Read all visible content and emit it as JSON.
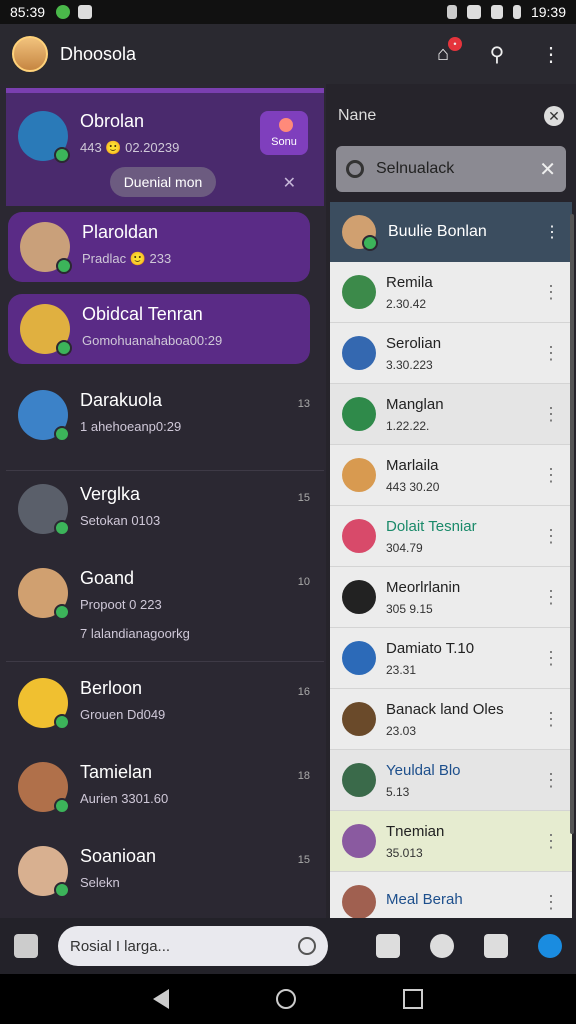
{
  "status": {
    "left_time": "85:39",
    "right_time": "19:39"
  },
  "appbar": {
    "title": "Dhoosola"
  },
  "pinned": {
    "name": "Obrolan",
    "sub": "443 🙂 02.20239",
    "pill": "Duenial mon",
    "tag": "Sonu"
  },
  "chats": [
    {
      "name": "Plaroldan",
      "sub": "Pradlac 🙂 233",
      "time": "",
      "highlight": true,
      "color": "#c9a07a"
    },
    {
      "name": "Obidcal Tenran",
      "sub": "Gomohuanahaboa00:29",
      "time": "",
      "highlight": true,
      "color": "#e0b040"
    },
    {
      "name": "Darakuola",
      "sub": "1 ahehoeanp0:29",
      "time": "13",
      "highlight": false,
      "color": "#3c82c8"
    },
    {
      "name": "Verglka",
      "sub": "Setokan 0103",
      "time": "15",
      "highlight": false,
      "color": "#5a5f6a"
    },
    {
      "name": "Goand",
      "sub": "Propoot 0 223",
      "time": "10",
      "highlight": false,
      "color": "#d0a070"
    },
    {
      "name": "Berloon",
      "sub": "Grouen Dd049",
      "time": "16",
      "highlight": false,
      "color": "#f0c030"
    },
    {
      "name": "Tamielan",
      "sub": "Aurien 3301.60",
      "time": "18",
      "highlight": false,
      "color": "#b0704a"
    },
    {
      "name": "Soanioan",
      "sub": "Selekn",
      "time": "15",
      "highlight": false,
      "color": "#d8b090"
    }
  ],
  "extra_line": "7 lalandianagoorkg",
  "right": {
    "head": "Nane",
    "search_value": "Selnualack",
    "contact_header": "Buulie Bonlan",
    "contacts": [
      {
        "name": "Remila",
        "sub": "2.30.42",
        "style": "",
        "color": "#3c8a4a"
      },
      {
        "name": "Serolian",
        "sub": "3.30.223",
        "style": "",
        "color": "#3468b0"
      },
      {
        "name": "Manglan",
        "sub": "1.22.22.",
        "style": "",
        "color": "#2f8a4a"
      },
      {
        "name": "Marlaila",
        "sub": "443 30.20",
        "style": "",
        "color": "#d89a50"
      },
      {
        "name": "Dolait Tesniar",
        "sub": "304.79",
        "style": "accent",
        "color": "#d84a6a"
      },
      {
        "name": "Meorlrlanin",
        "sub": "305 9.15",
        "style": "",
        "color": "#222"
      },
      {
        "name": "Damiato T.10",
        "sub": "23.31",
        "style": "",
        "color": "#2c6ab8"
      },
      {
        "name": "Banack land Oles",
        "sub": "23.03",
        "style": "",
        "color": "#6a4a2a"
      },
      {
        "name": "Yeuldal Blo",
        "sub": "5.13",
        "style": "blue",
        "color": "#3a6a4a"
      },
      {
        "name": "Tnemian",
        "sub": "35.013",
        "style": "",
        "color": "#8a5aa0"
      },
      {
        "name": "Meal Berah",
        "sub": "",
        "style": "blue",
        "color": "#a06050"
      }
    ]
  },
  "compose": {
    "placeholder": "Rosial I larga..."
  }
}
